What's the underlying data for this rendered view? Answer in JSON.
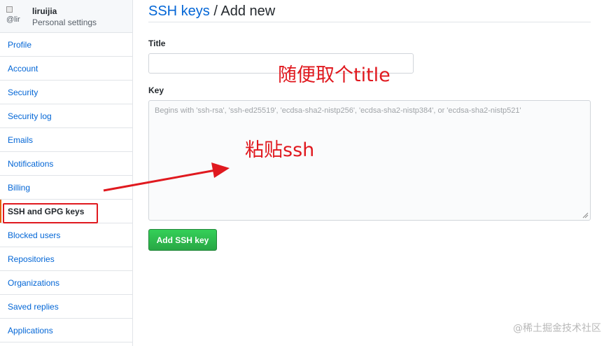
{
  "sidebar": {
    "avatar_alt": "@lir",
    "username": "liruijia",
    "subtitle": "Personal settings",
    "items": [
      {
        "label": "Profile"
      },
      {
        "label": "Account"
      },
      {
        "label": "Security"
      },
      {
        "label": "Security log"
      },
      {
        "label": "Emails"
      },
      {
        "label": "Notifications"
      },
      {
        "label": "Billing"
      },
      {
        "label": "SSH and GPG keys"
      },
      {
        "label": "Blocked users"
      },
      {
        "label": "Repositories"
      },
      {
        "label": "Organizations"
      },
      {
        "label": "Saved replies"
      },
      {
        "label": "Applications"
      }
    ]
  },
  "main": {
    "breadcrumb_link": "SSH keys",
    "breadcrumb_sep": "/",
    "breadcrumb_current": "Add new",
    "title_label": "Title",
    "title_value": "",
    "key_label": "Key",
    "key_placeholder": "Begins with 'ssh-rsa', 'ssh-ed25519', 'ecdsa-sha2-nistp256', 'ecdsa-sha2-nistp384', or 'ecdsa-sha2-nistp521'",
    "submit_label": "Add SSH key"
  },
  "annotations": {
    "title_note": "随便取个title",
    "key_note": "粘贴ssh",
    "color": "#e0191f"
  },
  "watermark": "@稀土掘金技术社区"
}
